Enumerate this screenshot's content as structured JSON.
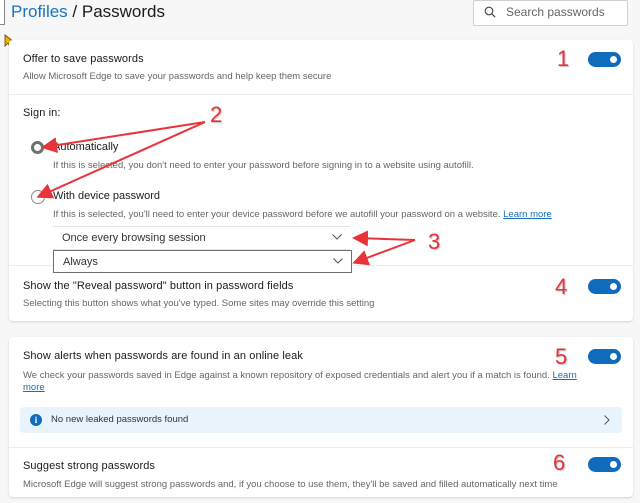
{
  "header": {
    "breadcrumb_parent": "Profiles",
    "breadcrumb_separator": " / ",
    "title": "Passwords"
  },
  "search": {
    "placeholder": "Search passwords",
    "value": "",
    "icon": "search-icon"
  },
  "settings": {
    "offer_to_save": {
      "title": "Offer to save passwords",
      "description": "Allow Microsoft Edge to save your passwords and help keep them secure",
      "enabled": true
    },
    "sign_in": {
      "label": "Sign in:",
      "options": [
        {
          "label": "Automatically",
          "description": "If this is selected, you don't need to enter your password before signing in to a website using autofill.",
          "selected": true
        },
        {
          "label": "With device password",
          "description": "If this is selected, you'll need to enter your device password before we autofill your password on a website.",
          "link": "Learn more",
          "selected": false
        }
      ],
      "dropdowns": [
        {
          "selected": "Once every browsing session"
        },
        {
          "selected": "Always"
        }
      ]
    },
    "reveal_password": {
      "title": "Show the \"Reveal password\" button in password fields",
      "description": "Selecting this button shows what you've typed. Some sites may override this setting",
      "enabled": true
    },
    "leak_alerts": {
      "title": "Show alerts when passwords are found in an online leak",
      "description": "We check your passwords saved in Edge against a known repository of exposed credentials and alert you if a match is found.",
      "link_part1": "Learn",
      "link_part2": "more",
      "enabled": true,
      "info": "No new leaked passwords found"
    },
    "strong_passwords": {
      "title": "Suggest strong passwords",
      "description": "Microsoft Edge will suggest strong passwords and, if you choose to use them, they'll be saved and filled automatically next time",
      "enabled": true
    }
  },
  "annotations": [
    "1",
    "2",
    "3",
    "4",
    "5",
    "6"
  ],
  "colors": {
    "accent": "#0f6cbd",
    "link": "#1a6fb8",
    "annotation": "#e8333a",
    "info_background": "#e8f3fc"
  }
}
